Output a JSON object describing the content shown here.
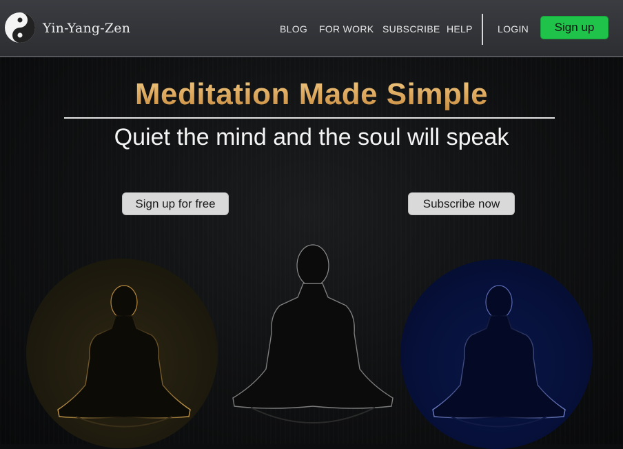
{
  "brand": {
    "name": "Yin-Yang-Zen",
    "logo_icon": "yin-yang-icon"
  },
  "nav": {
    "links": [
      "BLOG",
      "FOR WORK",
      "SUBSCRIBE",
      "HELP"
    ],
    "login": "LOGIN",
    "signup": "Sign up"
  },
  "hero": {
    "title": "Meditation Made Simple",
    "subtitle": "Quiet the mind and the soul will speak",
    "cta_primary": "Sign up for free",
    "cta_secondary": "Subscribe now"
  },
  "colors": {
    "accent_green": "#1fc34a",
    "title_gold": "#e0a95a",
    "left_glow": "#2a2412",
    "right_glow": "#07123a"
  },
  "images": [
    "meditating-figure-gold",
    "meditating-figure-center",
    "meditating-figure-blue"
  ]
}
